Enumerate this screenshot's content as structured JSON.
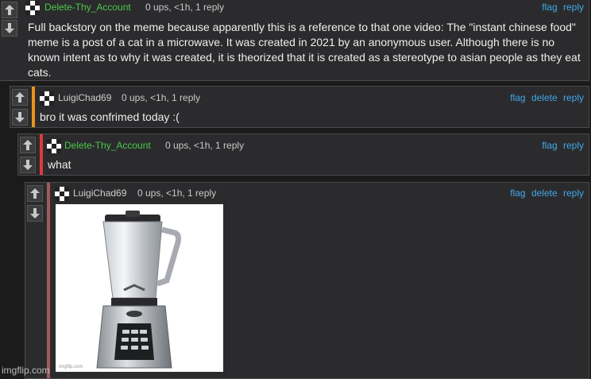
{
  "comments": [
    {
      "username": "Delete-Thy_Account",
      "meta": "0 ups, <1h, 1 reply",
      "actions": [
        "flag",
        "reply"
      ],
      "text": "Full backstory on the meme because apparently this is a reference to that one video: The \"instant chinese food\" meme is a post of a cat in a microwave. It was created in 2021 by an anonymous user. Although there is no known intent as to why it was created, it is theorized that it is created as a stereotype to asian people as they eat cats.",
      "name_color": "#4cc74c"
    },
    {
      "username": "LuigiChad69",
      "meta": "0 ups, <1h, 1 reply",
      "actions": [
        "flag",
        "delete",
        "reply"
      ],
      "text": "bro it was confrimed today :(",
      "name_color": "#cfcfcf",
      "accent_color": "#e8941a"
    },
    {
      "username": "Delete-Thy_Account",
      "meta": "0 ups, <1h, 1 reply",
      "actions": [
        "flag",
        "reply"
      ],
      "text": "what",
      "name_color": "#4cc74c",
      "accent_color": "#e03a3a"
    },
    {
      "username": "LuigiChad69",
      "meta": "0 ups, <1h, 1 reply",
      "actions": [
        "flag",
        "delete",
        "reply"
      ],
      "image_credit": "imgflip.com",
      "name_color": "#cfcfcf",
      "accent_color": "#a15a5a"
    }
  ],
  "watermark": "imgflip.com",
  "icons": {
    "upvote": "arrow-up-icon",
    "downvote": "arrow-down-icon",
    "avatar": "pixel-avatar-icon"
  }
}
